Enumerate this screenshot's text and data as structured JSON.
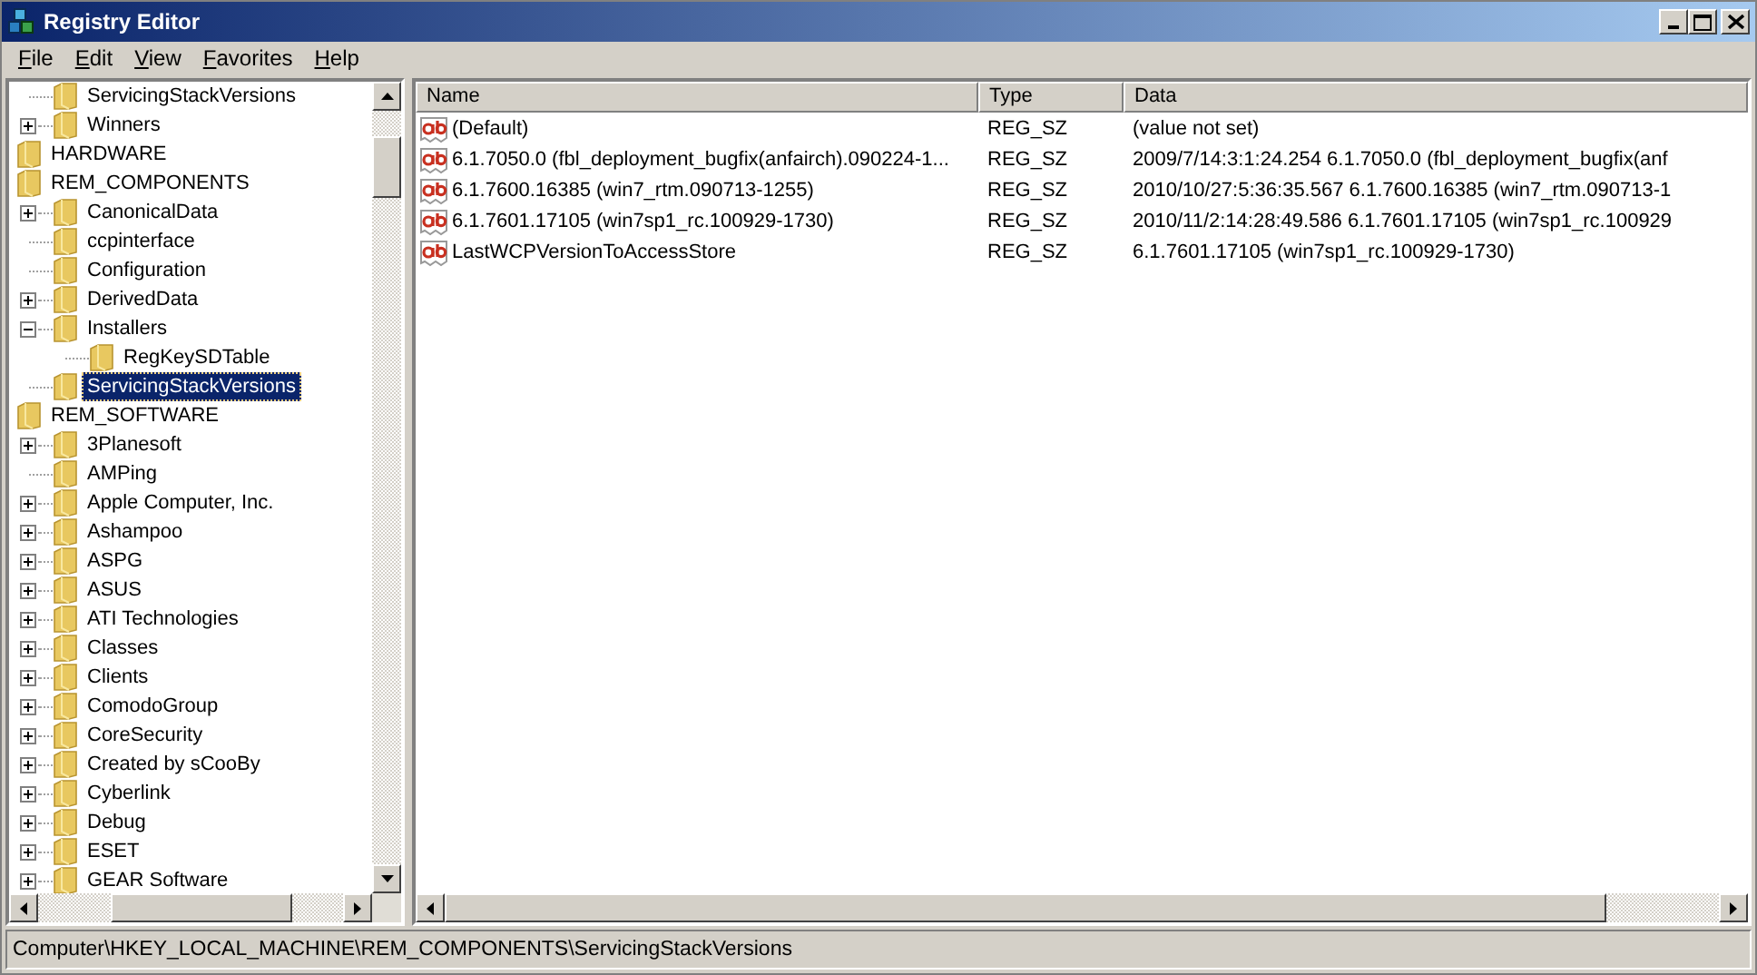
{
  "window": {
    "title": "Registry Editor"
  },
  "menu": [
    "File",
    "Edit",
    "View",
    "Favorites",
    "Help"
  ],
  "tree": {
    "items": [
      {
        "children": [
          {
            "label": "ServicingStackVersions",
            "selected": false
          },
          {
            "label": "Winners",
            "expanded": false,
            "selected": false
          }
        ]
      },
      {
        "label": "HARDWARE",
        "selected": false
      },
      {
        "label": "REM_COMPONENTS",
        "selected": false,
        "children": [
          {
            "label": "CanonicalData",
            "expanded": false,
            "selected": false
          },
          {
            "label": "ccpinterface",
            "selected": false
          },
          {
            "label": "Configuration",
            "selected": false
          },
          {
            "label": "DerivedData",
            "expanded": false,
            "selected": false
          },
          {
            "label": "Installers",
            "expanded": true,
            "selected": false,
            "children": [
              {
                "label": "RegKeySDTable",
                "selected": false
              }
            ]
          },
          {
            "label": "ServicingStackVersions",
            "selected": true
          }
        ]
      },
      {
        "label": "REM_SOFTWARE",
        "selected": false,
        "children": [
          {
            "label": "3Planesoft",
            "expanded": false,
            "selected": false
          },
          {
            "label": "AMPing",
            "selected": false
          },
          {
            "label": "Apple Computer, Inc.",
            "expanded": false,
            "selected": false
          },
          {
            "label": "Ashampoo",
            "expanded": false,
            "selected": false
          },
          {
            "label": "ASPG",
            "expanded": false,
            "selected": false
          },
          {
            "label": "ASUS",
            "expanded": false,
            "selected": false
          },
          {
            "label": "ATI Technologies",
            "expanded": false,
            "selected": false
          },
          {
            "label": "Classes",
            "expanded": false,
            "selected": false
          },
          {
            "label": "Clients",
            "expanded": false,
            "selected": false
          },
          {
            "label": "ComodoGroup",
            "expanded": false,
            "selected": false
          },
          {
            "label": "CoreSecurity",
            "expanded": false,
            "selected": false
          },
          {
            "label": "Created by sCooBy",
            "expanded": false,
            "selected": false
          },
          {
            "label": "Cyberlink",
            "expanded": false,
            "selected": false
          },
          {
            "label": "Debug",
            "expanded": false,
            "selected": false
          },
          {
            "label": "ESET",
            "expanded": false,
            "selected": false
          },
          {
            "label": "GEAR Software",
            "expanded": false,
            "selected": false
          }
        ]
      }
    ]
  },
  "table": {
    "columns": [
      "Name",
      "Type",
      "Data"
    ],
    "rows": [
      {
        "name": "(Default)",
        "type": "REG_SZ",
        "data": "(value not set)"
      },
      {
        "name": "6.1.7050.0 (fbl_deployment_bugfix(anfairch).090224-1...",
        "type": "REG_SZ",
        "data": "2009/7/14:3:1:24.254 6.1.7050.0 (fbl_deployment_bugfix(anf"
      },
      {
        "name": "6.1.7600.16385 (win7_rtm.090713-1255)",
        "type": "REG_SZ",
        "data": "2010/10/27:5:36:35.567 6.1.7600.16385 (win7_rtm.090713-1"
      },
      {
        "name": "6.1.7601.17105 (win7sp1_rc.100929-1730)",
        "type": "REG_SZ",
        "data": "2010/11/2:14:28:49.586 6.1.7601.17105 (win7sp1_rc.100929"
      },
      {
        "name": "LastWCPVersionToAccessStore",
        "type": "REG_SZ",
        "data": "6.1.7601.17105 (win7sp1_rc.100929-1730)"
      }
    ]
  },
  "status_bar": "Computer\\HKEY_LOCAL_MACHINE\\REM_COMPONENTS\\ServicingStackVersions"
}
